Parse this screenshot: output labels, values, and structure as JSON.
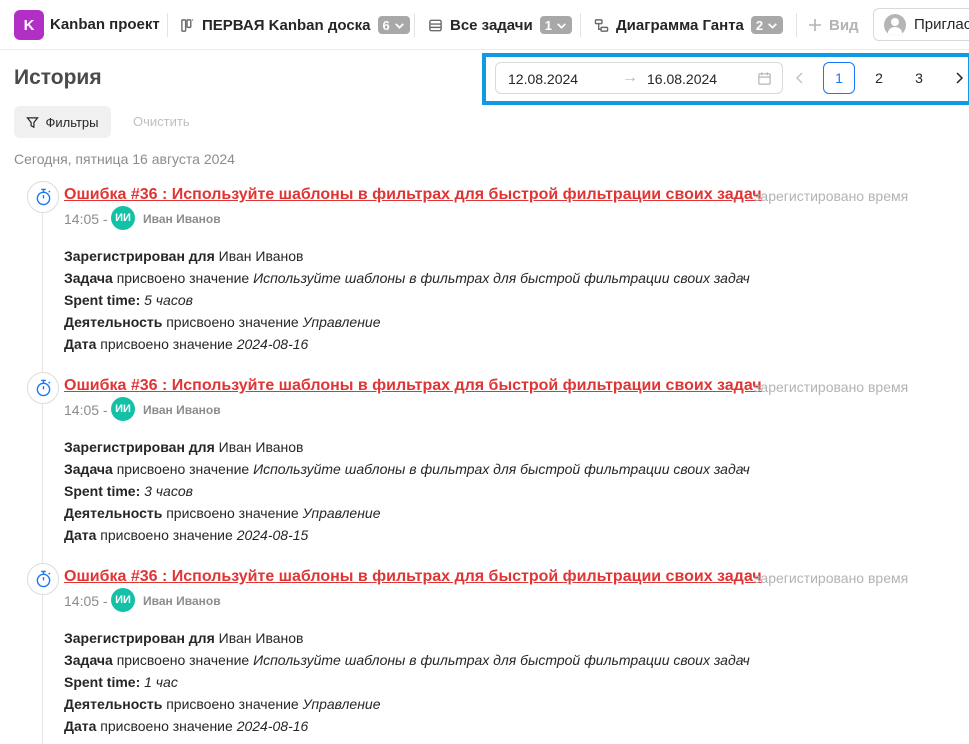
{
  "topbar": {
    "project_initial": "K",
    "project_name": "Kanban проект",
    "board": {
      "label": "ПЕРВАЯ Kanban доска",
      "count": "6"
    },
    "tasks": {
      "label": "Все задачи",
      "count": "1"
    },
    "gantt": {
      "label": "Диаграмма Ганта",
      "count": "2"
    },
    "view_label": "Вид",
    "invite_label": "Приглас"
  },
  "page": {
    "title": "История",
    "date_from": "12.08.2024",
    "date_arrow": "→",
    "date_to": "16.08.2024",
    "pagination": {
      "pages": [
        "1",
        "2",
        "3"
      ],
      "active": "1"
    },
    "filters_label": "Фильтры",
    "clear_label": "Очистить",
    "date_heading": "Сегодня, пятница 16 августа 2024"
  },
  "entries": [
    {
      "title": "Ошибка #36 : Используйте шаблоны в фильтрах для быстрой фильтрации своих задач",
      "action": "зарегистировано время",
      "time": "14:05 -",
      "avatar": "ИИ",
      "user": "Иван Иванов",
      "registered_label": "Зарегистрирован для",
      "registered_value": "Иван Иванов",
      "task_label": "Задача",
      "task_verb": "присвоено значение",
      "task_value": "Используйте шаблоны в фильтрах для быстрой фильтрации своих задач",
      "spent_label": "Spent time:",
      "spent_value": "5 часов",
      "activity_label": "Деятельность",
      "activity_verb": "присвоено значение",
      "activity_value": "Управление",
      "date_label": "Дата",
      "date_verb": "присвоено значение",
      "date_value": "2024-08-16"
    },
    {
      "title": "Ошибка #36 : Используйте шаблоны в фильтрах для быстрой фильтрации своих задач",
      "action": "зарегистировано время",
      "time": "14:05 -",
      "avatar": "ИИ",
      "user": "Иван Иванов",
      "registered_label": "Зарегистрирован для",
      "registered_value": "Иван Иванов",
      "task_label": "Задача",
      "task_verb": "присвоено значение",
      "task_value": "Используйте шаблоны в фильтрах для быстрой фильтрации своих задач",
      "spent_label": "Spent time:",
      "spent_value": "3 часов",
      "activity_label": "Деятельность",
      "activity_verb": "присвоено значение",
      "activity_value": "Управление",
      "date_label": "Дата",
      "date_verb": "присвоено значение",
      "date_value": "2024-08-15"
    },
    {
      "title": "Ошибка #36 : Используйте шаблоны в фильтрах для быстрой фильтрации своих задач",
      "action": "зарегистировано время",
      "time": "14:05 -",
      "avatar": "ИИ",
      "user": "Иван Иванов",
      "registered_label": "Зарегистрирован для",
      "registered_value": "Иван Иванов",
      "task_label": "Задача",
      "task_verb": "присвоено значение",
      "task_value": "Используйте шаблоны в фильтрах для быстрой фильтрации своих задач",
      "spent_label": "Spent time:",
      "spent_value": "1 час",
      "activity_label": "Деятельность",
      "activity_verb": "присвоено значение",
      "activity_value": "Управление",
      "date_label": "Дата",
      "date_verb": "присвоено значение",
      "date_value": "2024-08-16"
    }
  ]
}
